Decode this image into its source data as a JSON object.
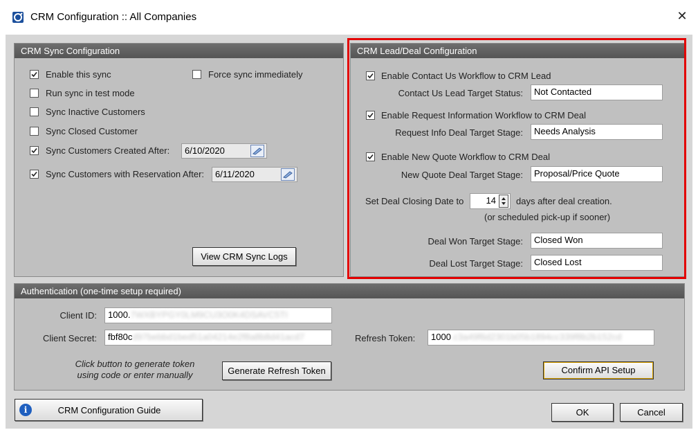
{
  "window": {
    "title": "CRM Configuration :: All Companies"
  },
  "sync": {
    "header": "CRM Sync Configuration",
    "enable": "Enable this sync",
    "force": "Force sync immediately",
    "test_mode": "Run sync in test mode",
    "inactive": "Sync Inactive Customers",
    "closed": "Sync Closed Customer",
    "created_after": "Sync Customers Created After:",
    "created_date": "6/10/2020",
    "reservation_after": "Sync Customers with Reservation After:",
    "reservation_date": "6/11/2020",
    "view_logs": "View CRM Sync Logs"
  },
  "lead": {
    "header": "CRM Lead/Deal Configuration",
    "contact_enable": "Enable Contact Us Workflow to CRM Lead",
    "contact_status_label": "Contact Us Lead Target Status:",
    "contact_status": "Not Contacted",
    "request_enable": "Enable Request Information Workflow to CRM Deal",
    "request_stage_label": "Request Info Deal Target Stage:",
    "request_stage": "Needs Analysis",
    "quote_enable": "Enable New Quote Workflow to CRM Deal",
    "quote_stage_label": "New Quote Deal Target Stage:",
    "quote_stage": "Proposal/Price Quote",
    "closing_prefix": "Set Deal Closing Date to",
    "closing_days": "14",
    "closing_suffix": "days after deal creation.",
    "closing_note": "(or scheduled pick-up if sooner)",
    "won_label": "Deal Won Target Stage:",
    "won": "Closed Won",
    "lost_label": "Deal Lost Target Stage:",
    "lost": "Closed Lost"
  },
  "auth": {
    "header": "Authentication (one-time setup required)",
    "client_id_label": "Client ID:",
    "client_id": "1000.",
    "client_id_hidden": "7WXBYPGY0LM9CU3O0K4DSAVC5TI",
    "client_secret_label": "Client Secret:",
    "client_secret": "fbf80c",
    "client_secret_hidden": "d97bebbd1bed51a04214e2f8a8b8d41acd7",
    "refresh_label": "Refresh Token:",
    "refresh": "1000",
    "refresh_hidden": ".c3a49f6d2301b05b1894cc339f8b2b152cd",
    "hint_line1": "Click button to generate token",
    "hint_line2": "using code or enter manually",
    "generate": "Generate Refresh Token",
    "confirm": "Confirm API Setup"
  },
  "footer": {
    "guide": "CRM Configuration Guide",
    "ok": "OK",
    "cancel": "Cancel"
  },
  "colors": {
    "highlight": "#e30000",
    "panel_header": "#5c5c5c",
    "confirm_border": "#e1a800"
  }
}
